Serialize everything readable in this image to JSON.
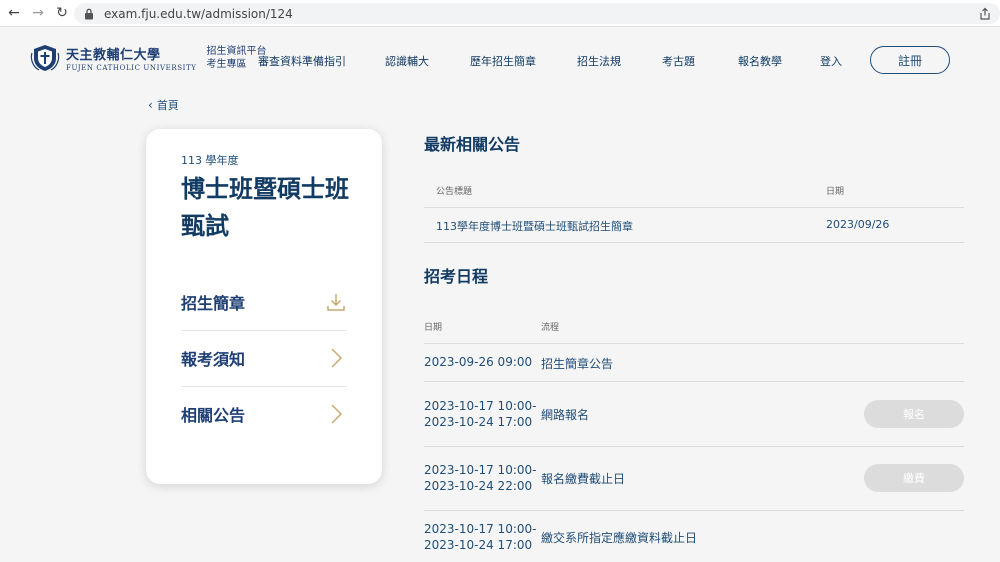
{
  "browser": {
    "url": "exam.fju.edu.tw/admission/124"
  },
  "header": {
    "logo_cn": "天主教輔仁大學",
    "logo_en": "FUJEN CATHOLIC UNIVERSITY",
    "platform_line1": "招生資訊平台",
    "platform_line2": "考生專區",
    "menu": [
      {
        "label": "審查資料準備指引"
      },
      {
        "label": "認識輔大"
      },
      {
        "label": "歷年招生簡章"
      },
      {
        "label": "招生法規"
      },
      {
        "label": "考古題"
      },
      {
        "label": "報名教學"
      },
      {
        "label": "登入"
      }
    ],
    "register_label": "註冊"
  },
  "breadcrumb": {
    "label": "首頁"
  },
  "card": {
    "year": "113 學年度",
    "title": "博士班暨碩士班甄試",
    "links": [
      {
        "label": "招生簡章",
        "icon": "download-icon"
      },
      {
        "label": "報考須知",
        "icon": "chevron-right-icon"
      },
      {
        "label": "相關公告",
        "icon": "chevron-right-icon"
      }
    ]
  },
  "announcements": {
    "title": "最新相關公告",
    "col_title": "公告標題",
    "col_date": "日期",
    "rows": [
      {
        "title": "113學年度博士班暨碩士班甄試招生簡章",
        "date": "2023/09/26"
      }
    ]
  },
  "schedule": {
    "title": "招考日程",
    "col_date": "日期",
    "col_step": "流程",
    "rows": [
      {
        "date_line1": "2023-09-26 09:00",
        "date_line2": "",
        "step": "招生簡章公告",
        "button": ""
      },
      {
        "date_line1": "2023-10-17 10:00-",
        "date_line2": "2023-10-24 17:00",
        "step": "網路報名",
        "button": "報名"
      },
      {
        "date_line1": "2023-10-17 10:00-",
        "date_line2": "2023-10-24 22:00",
        "step": "報名繳費截止日",
        "button": "繳費"
      },
      {
        "date_line1": "2023-10-17 10:00-",
        "date_line2": "2023-10-24 17:00",
        "step": "繳交系所指定應繳資料截止日",
        "button": ""
      }
    ]
  },
  "colors": {
    "primary": "#1f4e79",
    "accent_icon": "#c8a870",
    "disabled_button": "#dcdcdc"
  }
}
